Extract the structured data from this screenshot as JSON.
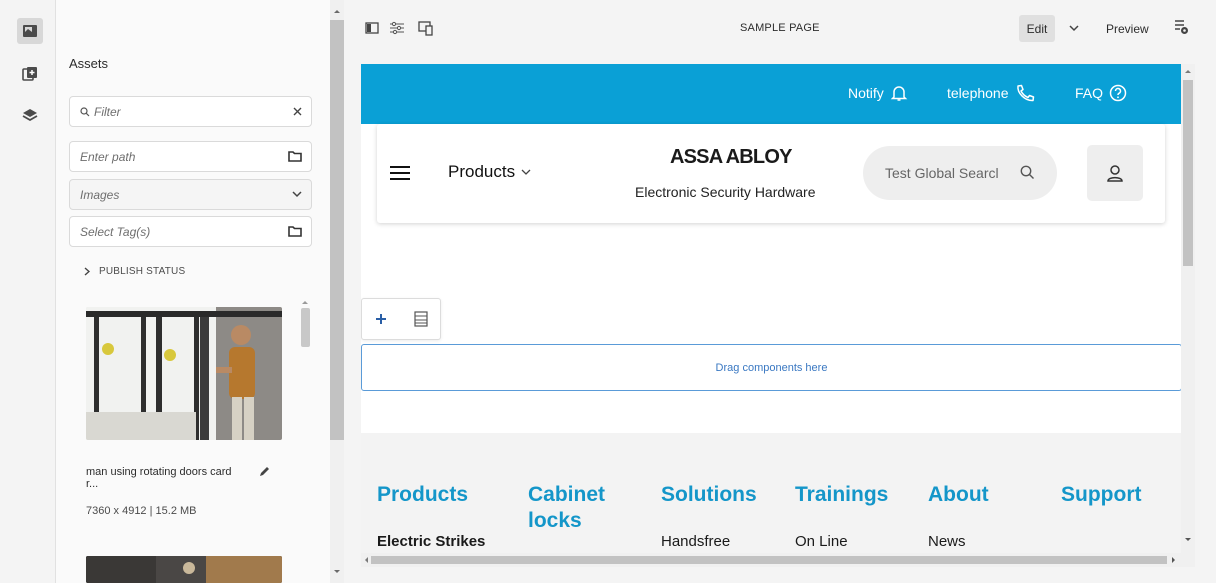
{
  "assets_panel": {
    "title": "Assets",
    "filter_placeholder": "Filter",
    "path_placeholder": "Enter path",
    "type_select": "Images",
    "tags_placeholder": "Select Tag(s)",
    "publish_status_label": "PUBLISH STATUS",
    "assets": [
      {
        "name": "man using rotating doors card r...",
        "meta": "7360 x 4912 | 15.2 MB"
      }
    ]
  },
  "editor_bar": {
    "page_title": "SAMPLE PAGE",
    "edit_label": "Edit",
    "preview_label": "Preview"
  },
  "site": {
    "utility": [
      {
        "label": "Notify",
        "icon": "bell-icon"
      },
      {
        "label": "telephone",
        "icon": "phone-icon"
      },
      {
        "label": "FAQ",
        "icon": "help-circle-icon"
      }
    ],
    "products_label": "Products",
    "logo": "ASSA ABLOY",
    "logo_subtitle": "Electronic Security Hardware",
    "search_placeholder": "Test Global Searcl",
    "dropzone_label": "Drag components here",
    "footer": {
      "columns": [
        "Products",
        "Cabinet locks",
        "Solutions",
        "Trainings",
        "About",
        "Support"
      ],
      "links": [
        "Electric Strikes",
        "Handsfree",
        "On Line",
        "News"
      ]
    },
    "colors": {
      "utility_bar": "#0aa0d6",
      "footer_heading": "#1496c9"
    }
  }
}
